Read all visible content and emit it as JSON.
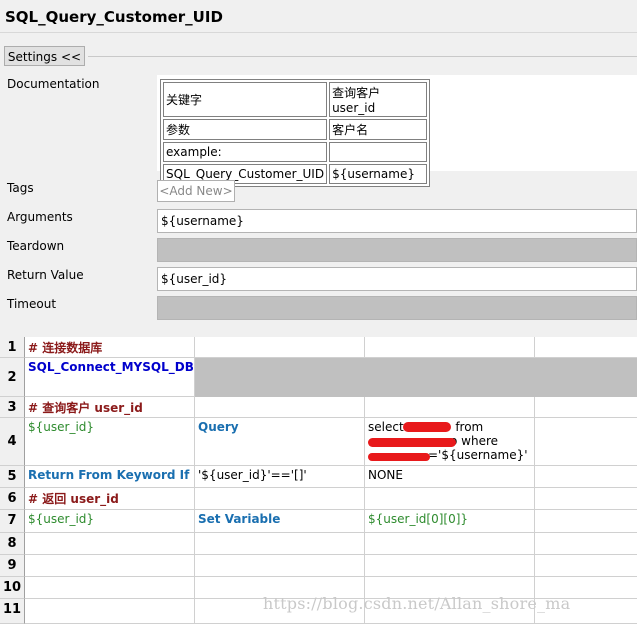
{
  "title": "SQL_Query_Customer_UID",
  "settings_button": "Settings <<",
  "labels": {
    "documentation": "Documentation",
    "tags": "Tags",
    "arguments": "Arguments",
    "teardown": "Teardown",
    "return_value": "Return Value",
    "timeout": "Timeout"
  },
  "documentation_table": [
    [
      "关键字",
      "查询客户 user_id"
    ],
    [
      "参数",
      "客户名"
    ],
    [
      "example:",
      ""
    ],
    [
      "SQL_Query_Customer_UID",
      "${username}"
    ]
  ],
  "tags_add": "<Add New>",
  "arguments_value": "${username}",
  "teardown_value": "",
  "return_value": "${user_id}",
  "timeout_value": "",
  "grid_rows": [
    {
      "num": "1",
      "a": "# 连接数据库",
      "b": "",
      "c": ""
    },
    {
      "num": "2",
      "a": "SQL_Connect_MYSQL_DB",
      "b": "",
      "c": ""
    },
    {
      "num": "3",
      "a": "# 查询客户 user_id",
      "b": "",
      "c": ""
    },
    {
      "num": "4",
      "a": "${user_id}",
      "b": "Query",
      "c_lines": [
        "select",
        "from",
        "o where",
        "='${username}'"
      ]
    },
    {
      "num": "5",
      "a": "Return From Keyword If",
      "b": "'${user_id}'=='[]'",
      "c": "NONE"
    },
    {
      "num": "6",
      "a": "# 返回 user_id",
      "b": "",
      "c": ""
    },
    {
      "num": "7",
      "a": "${user_id}",
      "b": "Set Variable",
      "c": "${user_id[0][0]}"
    },
    {
      "num": "8",
      "a": "",
      "b": "",
      "c": ""
    },
    {
      "num": "9",
      "a": "",
      "b": "",
      "c": ""
    },
    {
      "num": "10",
      "a": "",
      "b": "",
      "c": ""
    },
    {
      "num": "11",
      "a": "",
      "b": "",
      "c": ""
    }
  ],
  "watermark": "https://blog.csdn.net/Allan_shore_ma",
  "colors": {
    "comment": "#8b1a1a",
    "keyword": "#1a6fb0",
    "variable": "#2e8b2e",
    "redaction": "#e8191b"
  }
}
